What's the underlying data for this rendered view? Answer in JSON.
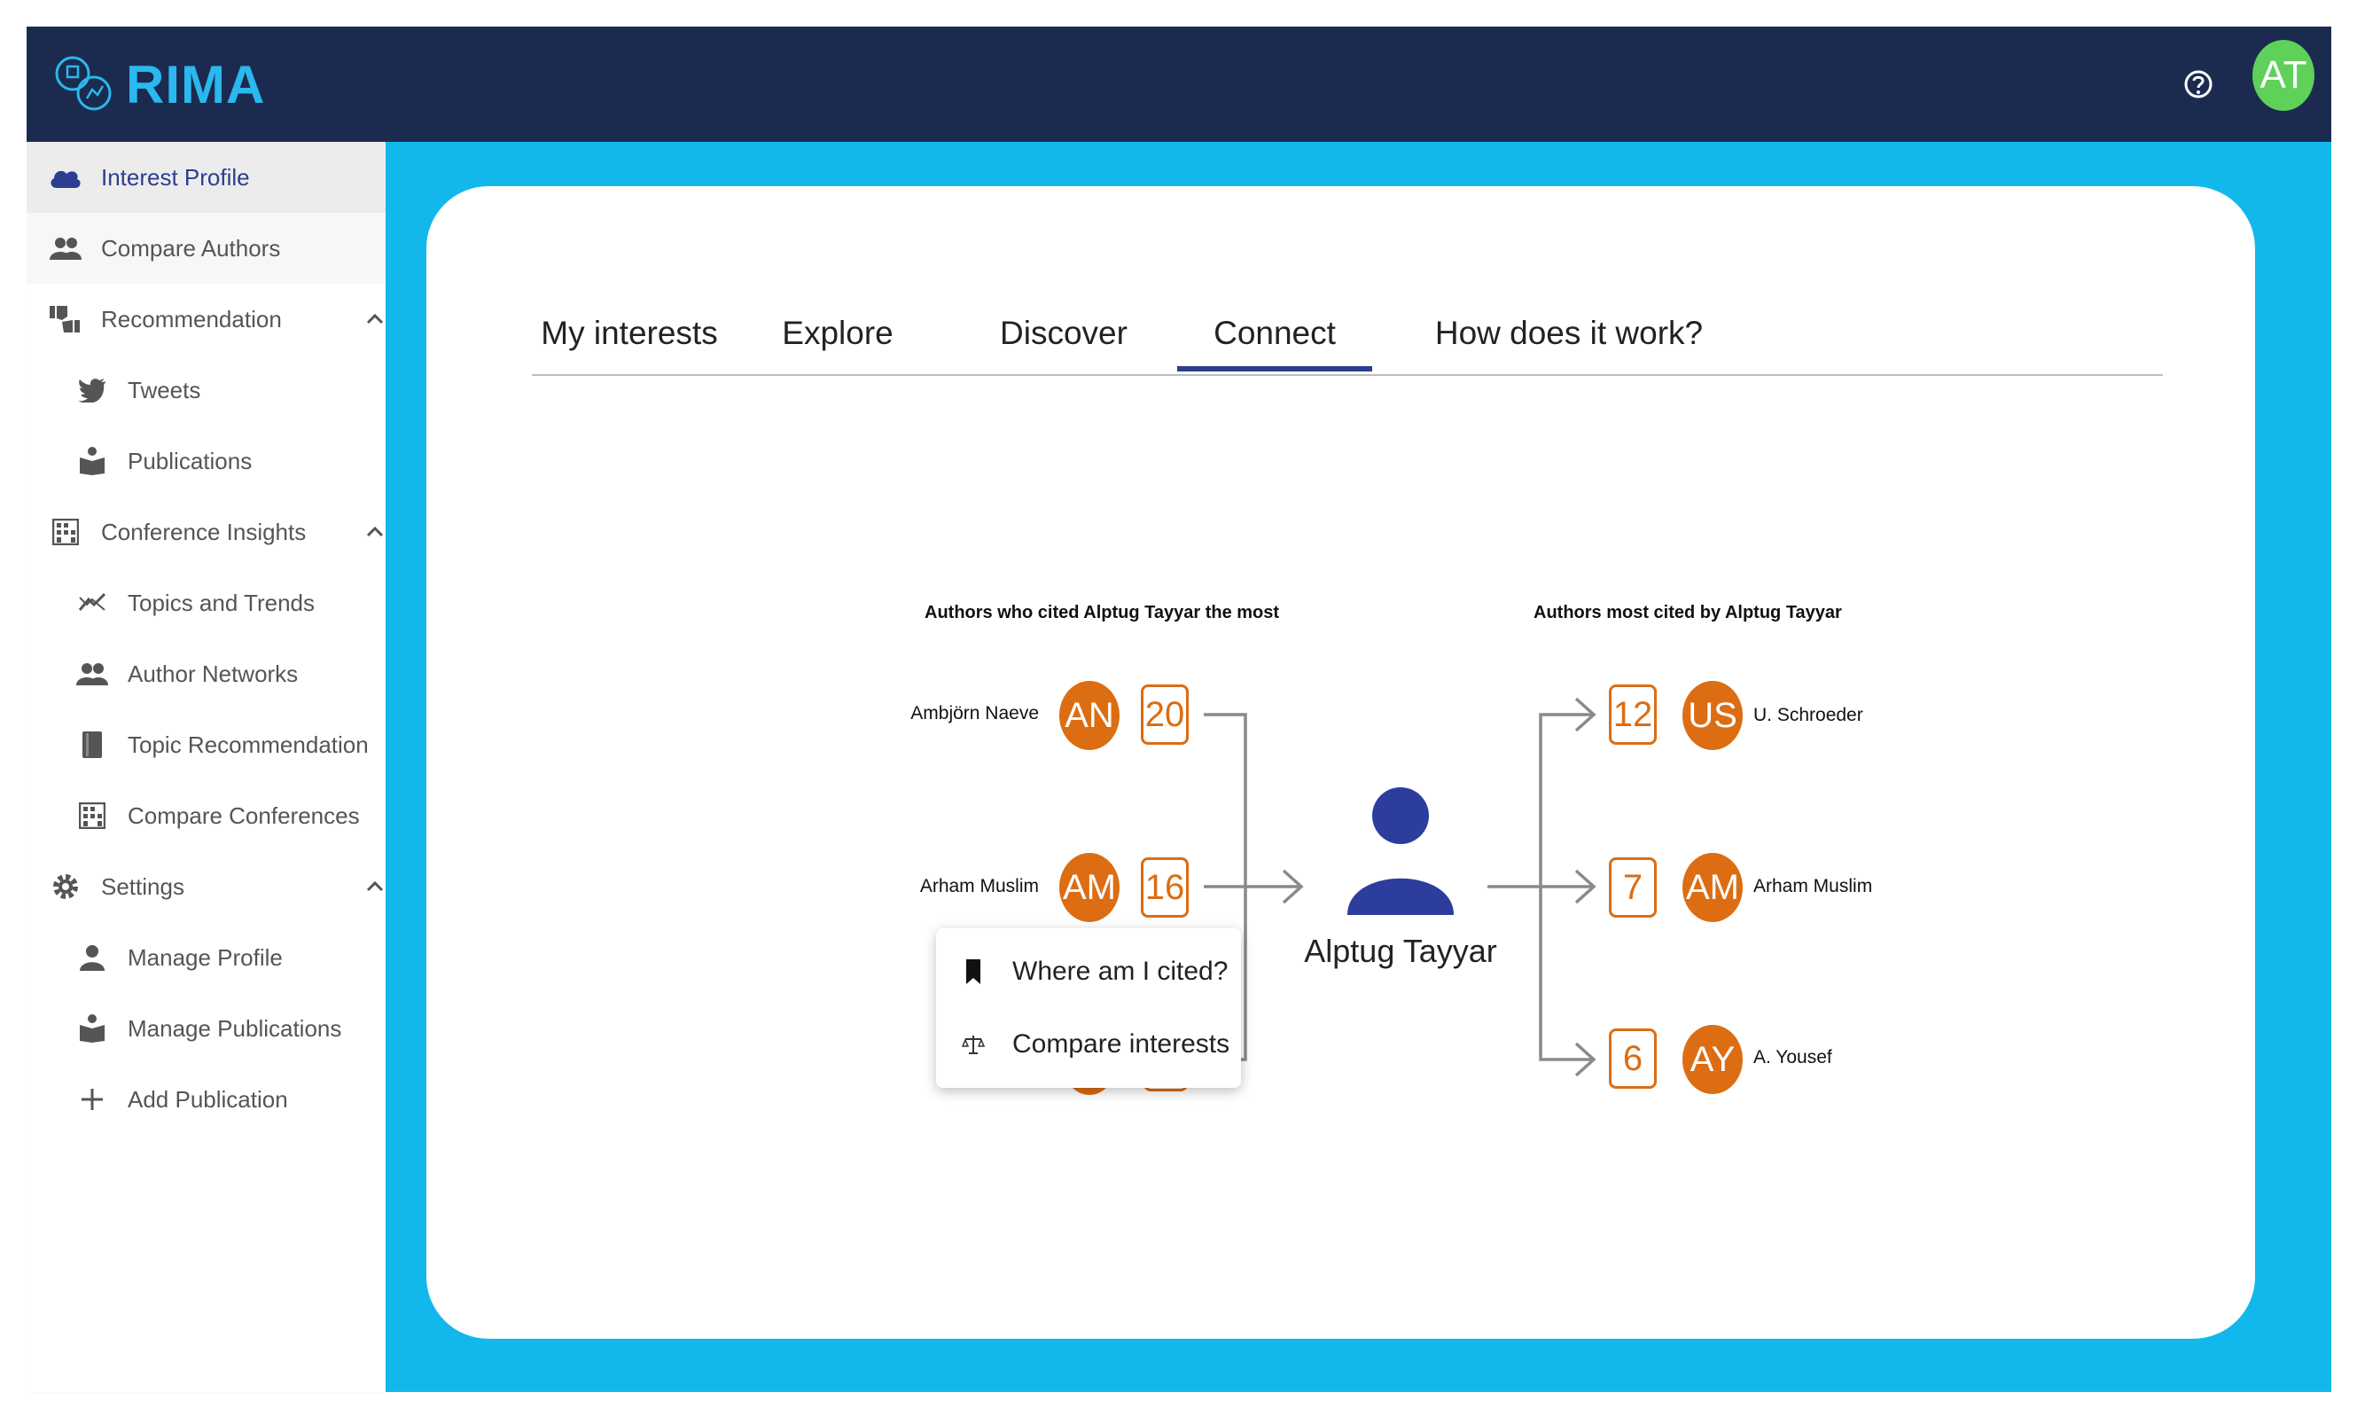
{
  "app": {
    "name": "RIMA",
    "user_initials": "AT"
  },
  "sidebar": {
    "items": [
      {
        "label": "Interest Profile",
        "icon": "cloud-icon"
      },
      {
        "label": "Compare Authors",
        "icon": "people-icon"
      },
      {
        "label": "Recommendation",
        "icon": "thumbs-icon"
      },
      {
        "label": "Tweets",
        "icon": "twitter-icon"
      },
      {
        "label": "Publications",
        "icon": "reader-icon"
      },
      {
        "label": "Conference Insights",
        "icon": "building-icon"
      },
      {
        "label": "Topics and Trends",
        "icon": "trend-icon"
      },
      {
        "label": "Author Networks",
        "icon": "people-icon"
      },
      {
        "label": "Topic Recommendation",
        "icon": "book-icon"
      },
      {
        "label": "Compare Conferences",
        "icon": "building-icon"
      },
      {
        "label": "Settings",
        "icon": "gear-icon"
      },
      {
        "label": "Manage Profile",
        "icon": "person-icon"
      },
      {
        "label": "Manage Publications",
        "icon": "reader-icon"
      },
      {
        "label": "Add Publication",
        "icon": "plus-icon"
      }
    ]
  },
  "tabs": [
    {
      "label": "My interests"
    },
    {
      "label": "Explore"
    },
    {
      "label": "Discover"
    },
    {
      "label": "Connect"
    },
    {
      "label": "How does it work?"
    }
  ],
  "active_tab": "Connect",
  "connect": {
    "left_title": "Authors who cited Alptug Tayyar the most",
    "right_title": "Authors most cited by Alptug Tayyar",
    "center_name": "Alptug Tayyar",
    "citing_authors": [
      {
        "name": "Ambjörn Naeve",
        "initials": "AN",
        "count": "20"
      },
      {
        "name": "Arham Muslim",
        "initials": "AM",
        "count": "16"
      }
    ],
    "cited_authors": [
      {
        "name": "U. Schroeder",
        "initials": "US",
        "count": "12"
      },
      {
        "name": "Arham Muslim",
        "initials": "AM",
        "count": "7"
      },
      {
        "name": "A. Yousef",
        "initials": "AY",
        "count": "6"
      }
    ],
    "menu": {
      "where_cited": "Where am I cited?",
      "compare_interests": "Compare interests"
    }
  },
  "colors": {
    "topbar": "#1b2b4f",
    "logo": "#2ab8ee",
    "content_bg": "#12b8ec",
    "accent": "#2d3d8f",
    "orange": "#dc6d12",
    "avatar": "#5fd05a"
  }
}
